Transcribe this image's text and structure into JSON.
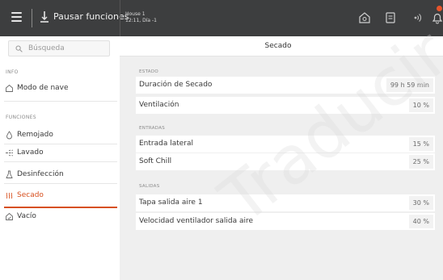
{
  "topbar": {
    "pause_label": "Pausar funciones",
    "house_name": "House 1",
    "house_time": "12:11, Día -1",
    "icons": [
      "menu-icon",
      "pause-icon",
      "home-icon",
      "document-icon",
      "signal-icon",
      "alarm-bell-icon"
    ]
  },
  "sidebar": {
    "search_placeholder": "Búsqueda",
    "info_label": "INFO",
    "nave_mode": "Modo de nave",
    "functions_label": "FUNCIONES",
    "items": [
      {
        "label": "Remojado",
        "icon": "drop-icon"
      },
      {
        "label": "Lavado",
        "icon": "spray-icon"
      },
      {
        "label": "Desinfección",
        "icon": "flask-icon"
      },
      {
        "label": "Secado",
        "icon": "heat-icon",
        "active": true
      },
      {
        "label": "Vacío",
        "icon": "empty-icon"
      }
    ]
  },
  "main": {
    "title": "Secado",
    "groups": [
      {
        "label": "ESTADO",
        "rows": [
          {
            "label": "Duración de Secado",
            "value": "99 h 59 min"
          },
          {
            "label": "Ventilación",
            "value": "10 %"
          }
        ]
      },
      {
        "label": "ENTRADAS",
        "rows": [
          {
            "label": "Entrada lateral",
            "value": "15 %"
          },
          {
            "label": "Soft Chill",
            "value": "25 %"
          }
        ]
      },
      {
        "label": "SALIDAS",
        "rows": [
          {
            "label": "Tapa salida aire 1",
            "value": "30 %"
          },
          {
            "label": "Velocidad ventilador salida aire",
            "value": "40 %"
          }
        ]
      }
    ]
  },
  "watermark": "Traducir",
  "colors": {
    "accent": "#d7501f",
    "topbar": "#3d3e3f",
    "main_bg": "#efefef"
  }
}
